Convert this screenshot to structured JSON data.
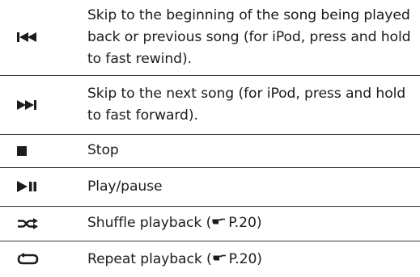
{
  "rows": [
    {
      "icon": "skip-back-icon",
      "text": "Skip to the beginning of the song being played back or previous song (for iPod, press and hold to fast rewind)."
    },
    {
      "icon": "skip-forward-icon",
      "text": "Skip to the next song (for iPod, press and hold to fast forward)."
    },
    {
      "icon": "stop-icon",
      "text": "Stop"
    },
    {
      "icon": "play-pause-icon",
      "text": "Play/pause"
    },
    {
      "icon": "shuffle-icon",
      "text_before": "Shuffle playback (",
      "ref_symbol": "pointing-hand-icon",
      "ref_page": "P.20",
      "text_after": ")"
    },
    {
      "icon": "repeat-icon",
      "text_before": "Repeat playback (",
      "ref_symbol": "pointing-hand-icon",
      "ref_page": "P.20",
      "text_after": ")"
    }
  ]
}
